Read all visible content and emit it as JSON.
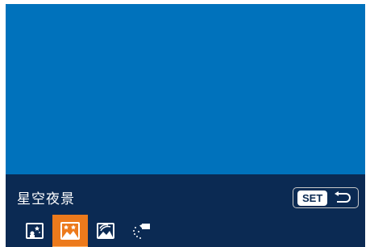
{
  "mode": {
    "current_name": "星空夜景"
  },
  "set_hint": {
    "key_label": "SET",
    "action_icon": "return-arrow-icon"
  },
  "mode_strip": {
    "items": [
      {
        "icon": "star-portrait-icon",
        "selected": false
      },
      {
        "icon": "star-nightscape-icon",
        "selected": true
      },
      {
        "icon": "star-trails-icon",
        "selected": false
      },
      {
        "icon": "star-time-lapse-movie-icon",
        "selected": false
      }
    ]
  },
  "colors": {
    "preview_bg": "#0072bc",
    "bar_bg": "#0b2a53",
    "selected_bg": "#ec7a1c"
  }
}
